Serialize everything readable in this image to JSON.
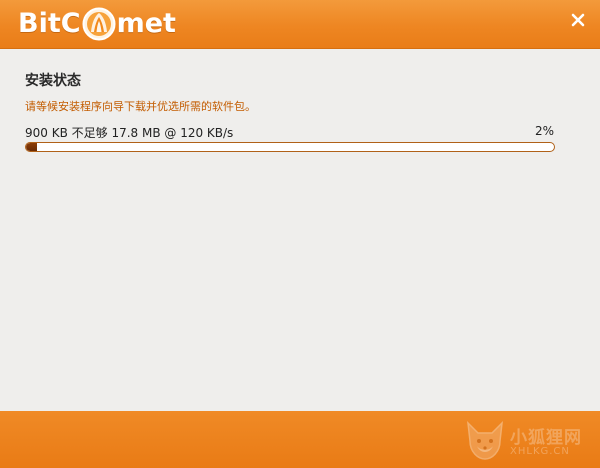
{
  "header": {
    "brand_prefix": "BitC",
    "brand_suffix": "met",
    "close_glyph": "✕",
    "brand_color": "#ee8622"
  },
  "main": {
    "section_title": "安装状态",
    "section_subtitle": "请等候安装程序向导下载并优选所需的软件包。",
    "progress_text": "900 KB 不足够 17.8 MB @ 120 KB/s",
    "progress_percent_label": "2%",
    "progress_fraction": 0.02
  },
  "watermark": {
    "title": "小狐狸网",
    "subtitle": "XHLKG.CN"
  },
  "icons": {
    "logo": "comet-logo-icon",
    "close": "close-icon",
    "watermark": "fox-icon"
  }
}
